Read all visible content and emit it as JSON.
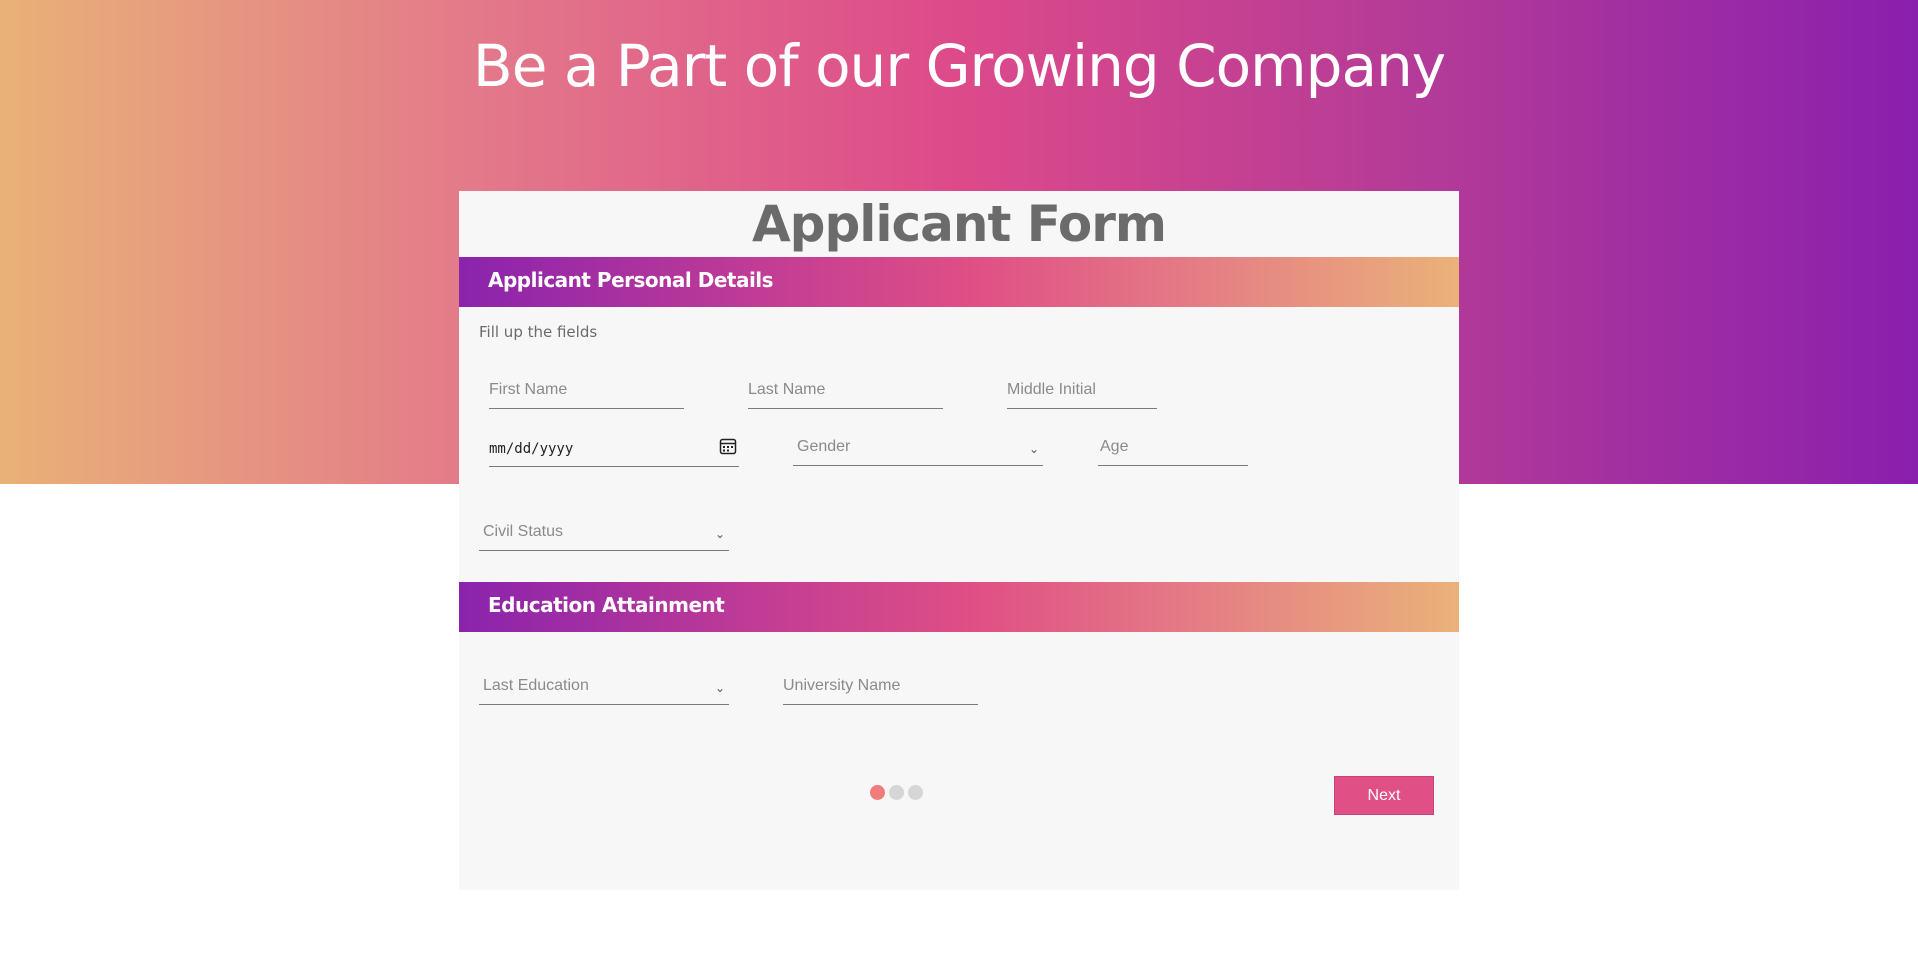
{
  "hero": {
    "title": "Be a Part of our Growing Company"
  },
  "form": {
    "title": "Applicant Form",
    "personal": {
      "header": "Applicant Personal Details",
      "hint": "Fill up the fields",
      "first_name_placeholder": "First Name",
      "last_name_placeholder": "Last Name",
      "middle_initial_placeholder": "Middle Initial",
      "date_placeholder": "mm/dd/yyyy",
      "gender_placeholder": "Gender",
      "age_placeholder": "Age",
      "civil_status_placeholder": "Civil Status"
    },
    "education": {
      "header": "Education Attainment",
      "last_education_placeholder": "Last Education",
      "university_placeholder": "University Name"
    },
    "steps": {
      "current": 1,
      "total": 3
    },
    "next_label": "Next"
  },
  "colors": {
    "accent": "#e04f86",
    "active_step": "#f07c7c",
    "gradient_start": "#e9b177",
    "gradient_end": "#8a1fae"
  },
  "icons": {
    "date": "calendar-icon",
    "select": "chevron-down-icon"
  }
}
